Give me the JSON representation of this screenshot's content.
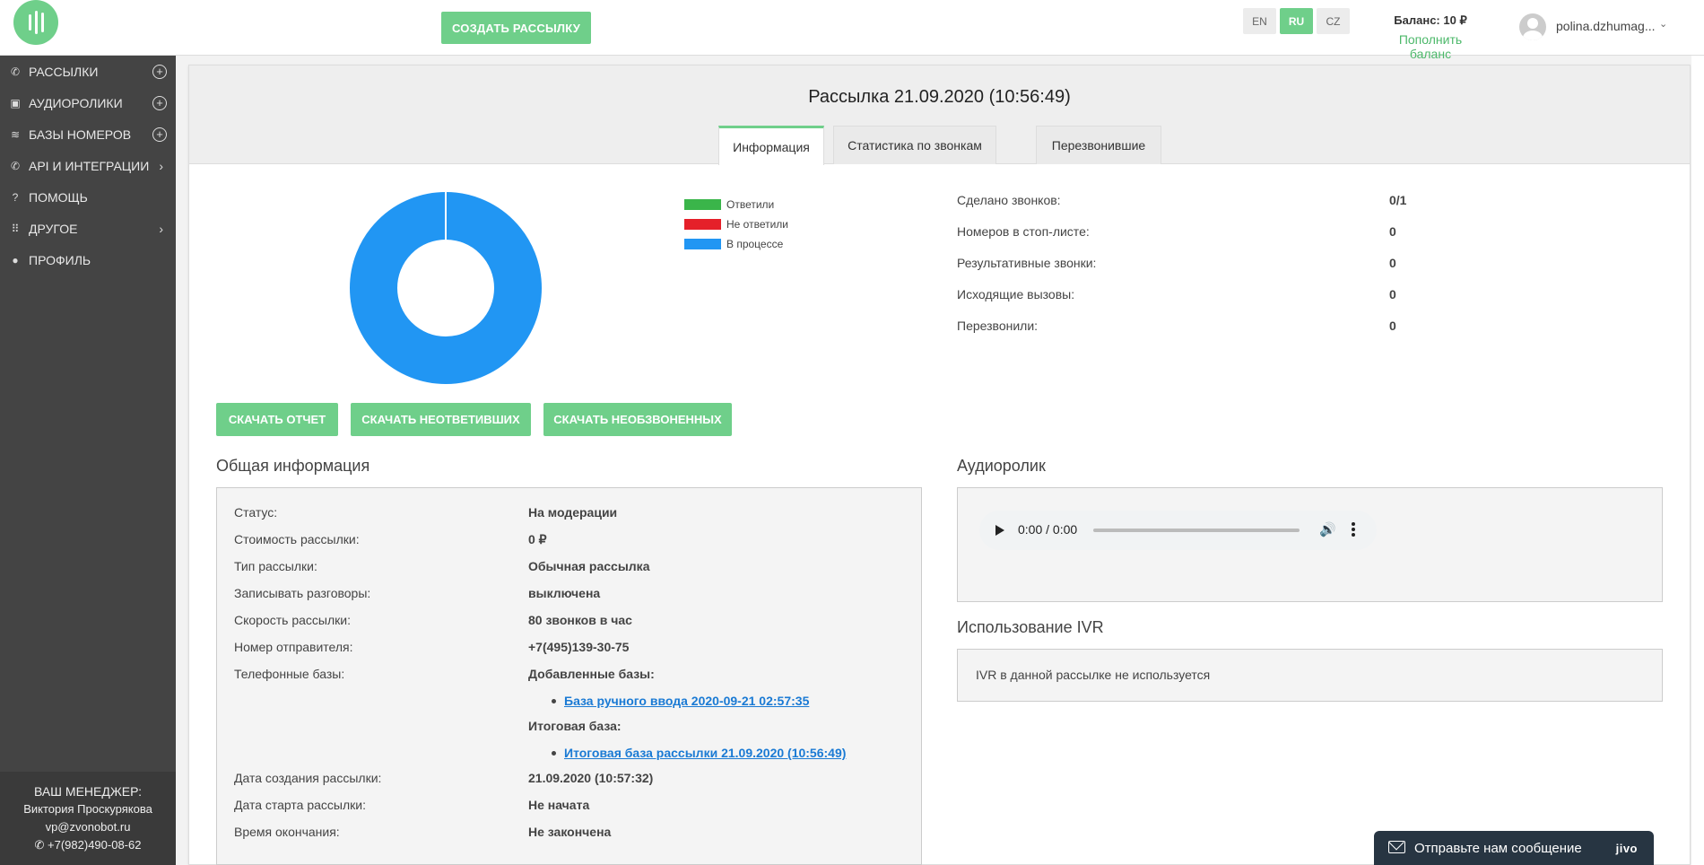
{
  "header": {
    "create_button": "СОЗДАТЬ РАССЫЛКУ",
    "languages": [
      "EN",
      "RU",
      "CZ"
    ],
    "active_language": "RU",
    "balance": "Баланс: 10 ₽",
    "topup": "Пополнить баланс",
    "username": "polina.dzhumag...",
    "user_chevron": "⌄"
  },
  "sidebar": {
    "items": [
      {
        "label": "РАССЫЛКИ",
        "icon": "phone-icon",
        "action": "+"
      },
      {
        "label": "АУДИОРОЛИКИ",
        "icon": "audio-icon",
        "action": "+"
      },
      {
        "label": "БАЗЫ НОМЕРОВ",
        "icon": "database-icon",
        "action": "+"
      },
      {
        "label": "API И ИНТЕГРАЦИИ",
        "icon": "integration-icon",
        "chevron": "›"
      },
      {
        "label": "ПОМОЩЬ",
        "icon": "help-icon"
      },
      {
        "label": "ДРУГОЕ",
        "icon": "grid-icon",
        "chevron": "›"
      },
      {
        "label": "ПРОФИЛЬ",
        "icon": "user-icon"
      }
    ],
    "manager": {
      "title": "ВАШ МЕНЕДЖЕР:",
      "name": "Виктория Проскурякова",
      "email": "vp@zvonobot.ru",
      "phone": "+7(982)490-08-62"
    }
  },
  "page": {
    "title": "Рассылка 21.09.2020 (10:56:49)",
    "tabs": [
      "Информация",
      "Статистика по звонкам",
      "Перезвонившие"
    ],
    "active_tab": "Информация"
  },
  "chart_data": {
    "type": "pie",
    "categories": [
      "Ответили",
      "Не ответили",
      "В процессе"
    ],
    "values": [
      0,
      0,
      1
    ],
    "colors": [
      "#3ab54a",
      "#e52029",
      "#2196f3"
    ],
    "donut": true,
    "legend_position": "right"
  },
  "stats": [
    {
      "label": "Сделано звонков:",
      "value": "0/1"
    },
    {
      "label": "Номеров в стоп-листе:",
      "value": "0"
    },
    {
      "label": "Результативные звонки:",
      "value": "0"
    },
    {
      "label": "Исходящие вызовы:",
      "value": "0"
    },
    {
      "label": "Перезвонили:",
      "value": "0"
    }
  ],
  "buttons": {
    "download_report": "СКАЧАТЬ ОТЧЕТ",
    "download_unanswered": "СКАЧАТЬ НЕОТВЕТИВШИХ",
    "download_uncalled": "СКАЧАТЬ НЕОБЗВОНЕННЫХ"
  },
  "general": {
    "title": "Общая информация",
    "rows": [
      {
        "label": "Статус:",
        "value": "На модерации"
      },
      {
        "label": "Стоимость рассылки:",
        "value": "0 ₽"
      },
      {
        "label": "Тип рассылки:",
        "value": "Обычная рассылка"
      },
      {
        "label": "Записывать разговоры:",
        "value": "выключена"
      },
      {
        "label": "Скорость рассылки:",
        "value": "80 звонков в час"
      },
      {
        "label": "Номер отправителя:",
        "value": "+7(495)139-30-75"
      },
      {
        "label": "Телефонные базы:",
        "value": "Добавленные базы:"
      }
    ],
    "added_base_link": "База ручного ввода 2020-09-21 02:57:35",
    "final_base_title": "Итоговая база:",
    "final_base_link": "Итоговая база рассылки 21.09.2020 (10:56:49)",
    "rows2": [
      {
        "label": "Дата создания рассылки:",
        "value": "21.09.2020 (10:57:32)"
      },
      {
        "label": "Дата старта рассылки:",
        "value": "Не начата"
      },
      {
        "label": "Время окончания:",
        "value": "Не закончена"
      }
    ]
  },
  "audio": {
    "title": "Аудиоролик",
    "time": "0:00 / 0:00",
    "progress": 0
  },
  "ivr": {
    "title": "Использование IVR",
    "text": "IVR в данной рассылке не используется"
  },
  "chat": {
    "text": "Отправьте нам сообщение",
    "brand": "jivo"
  }
}
